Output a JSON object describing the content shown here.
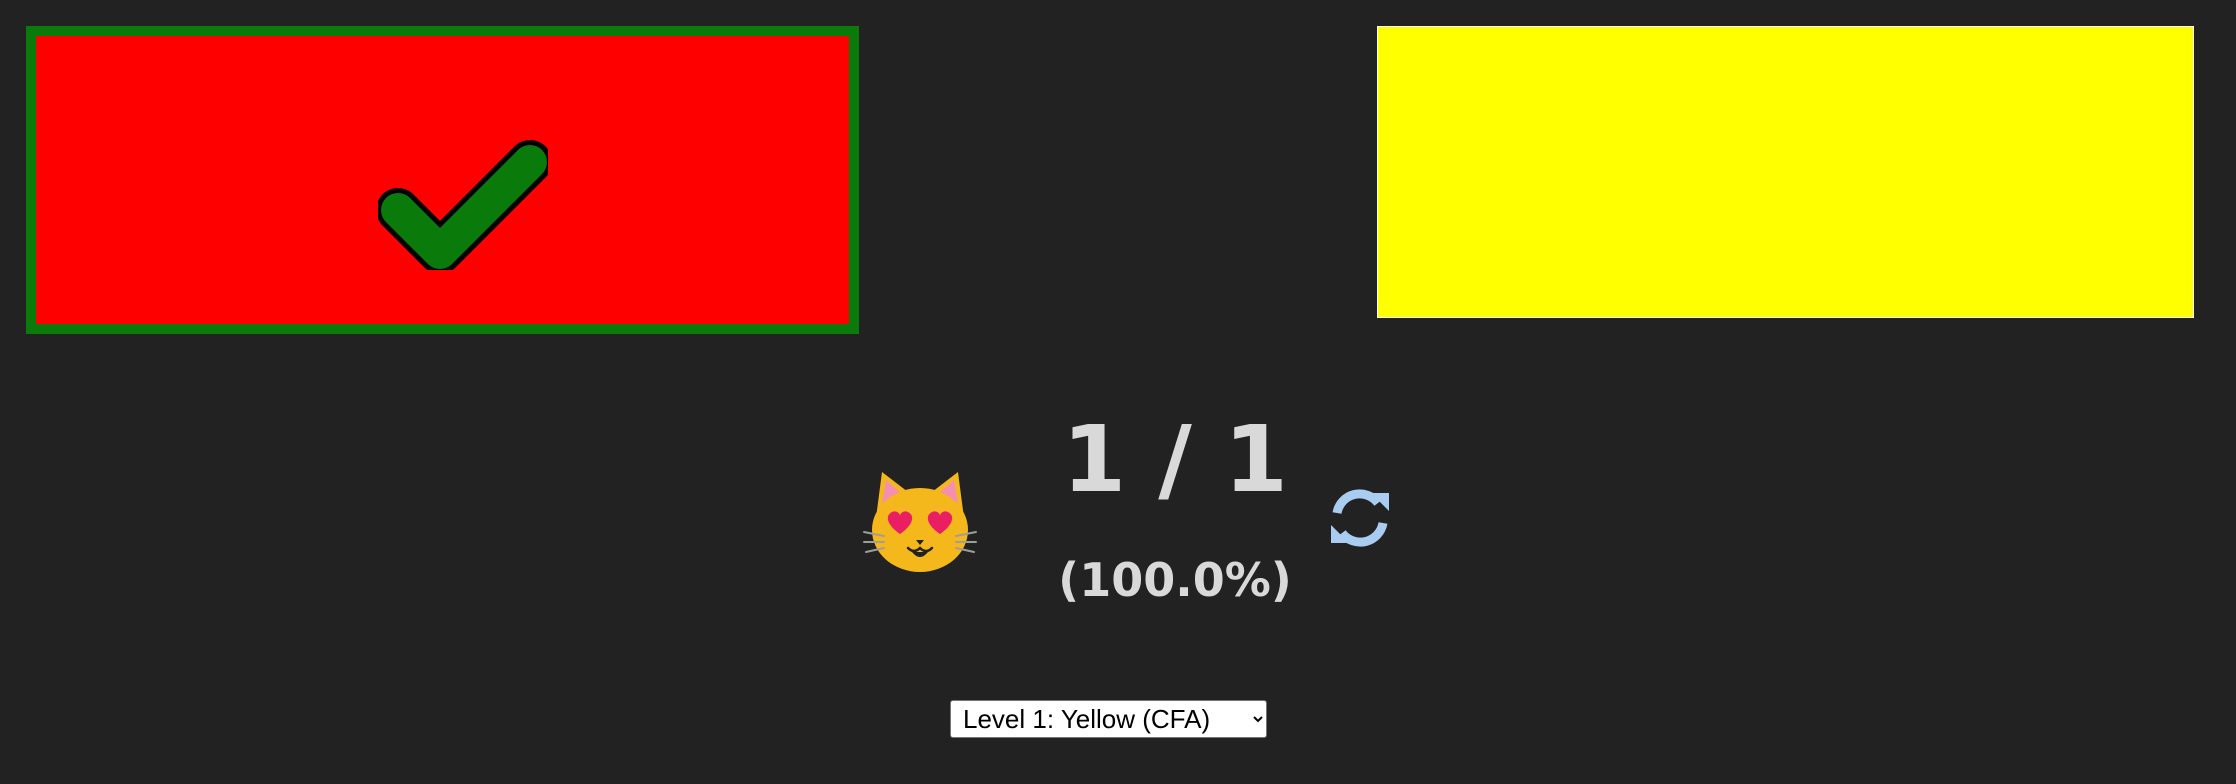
{
  "swatches": {
    "left": {
      "color": "#ff0000",
      "border_color": "#0a7a0a",
      "state": "correct",
      "icon": "checkmark-icon"
    },
    "right": {
      "color": "#ffff00",
      "border_color": "#ffffff"
    }
  },
  "feedback": {
    "icon": "smiling-cat-heart-eyes-icon"
  },
  "score": {
    "text": "1 / 1",
    "correct": 1,
    "total": 1,
    "percent_text": "(100.0%)"
  },
  "controls": {
    "refresh_icon": "refresh-icon",
    "refresh_color": "#a9cdf0",
    "level_select": {
      "selected": "Level 1: Yellow (CFA)",
      "options": [
        "Level 1: Yellow (CFA)"
      ]
    }
  }
}
